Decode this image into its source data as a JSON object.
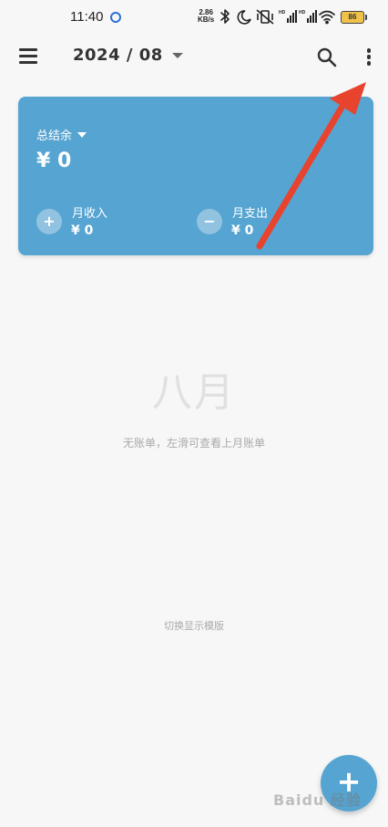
{
  "status_bar": {
    "time": "11:40",
    "speed_value": "2.86",
    "speed_unit": "KB/s",
    "battery": "86",
    "icons": [
      "record-icon",
      "bluetooth-icon",
      "moon-icon",
      "vibrate-icon",
      "signal-icon",
      "signal-icon",
      "wifi-icon",
      "battery-icon"
    ]
  },
  "app_bar": {
    "month": "2024 / 08",
    "icons": [
      "menu-icon",
      "chevron-down-icon",
      "search-icon",
      "more-vert-icon"
    ]
  },
  "summary": {
    "balance_label": "总结余",
    "balance_value": "¥ 0",
    "income_label": "月收入",
    "income_value": "¥ 0",
    "income_icon": "+",
    "expense_label": "月支出",
    "expense_value": "¥ 0",
    "expense_icon": "−"
  },
  "empty_state": {
    "month_name": "八月",
    "hint": "无账单，左滑可查看上月账单"
  },
  "footer": {
    "switch_template": "切换显示模版"
  },
  "fab": {
    "icon": "+"
  },
  "watermark": {
    "text": "Baidu 经验"
  },
  "colors": {
    "accent": "#56a4d1",
    "background": "#f7f7f7",
    "annotation_arrow": "#e8432f"
  }
}
